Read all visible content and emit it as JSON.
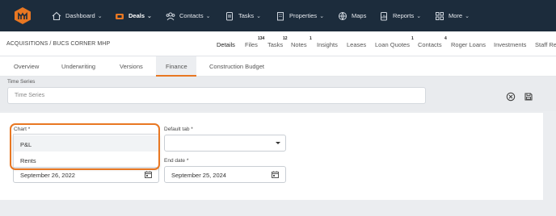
{
  "topnav": {
    "items": [
      {
        "label": "Dashboard",
        "icon": "home-icon",
        "has_menu": true
      },
      {
        "label": "Deals",
        "icon": "deals-icon",
        "has_menu": true,
        "active": true
      },
      {
        "label": "Contacts",
        "icon": "contacts-icon",
        "has_menu": true
      },
      {
        "label": "Tasks",
        "icon": "tasks-icon",
        "has_menu": true
      },
      {
        "label": "Properties",
        "icon": "building-icon",
        "has_menu": true
      },
      {
        "label": "Maps",
        "icon": "globe-icon",
        "has_menu": false
      },
      {
        "label": "Reports",
        "icon": "reports-icon",
        "has_menu": true
      },
      {
        "label": "More",
        "icon": "grid-icon",
        "has_menu": true
      }
    ],
    "accent": "#e87722",
    "bg": "#1c2c3c"
  },
  "breadcrumb": "ACQUISITIONS / BUCS CORNER MHP",
  "record_tabs": [
    {
      "label": "Details",
      "active": true
    },
    {
      "label": "Files",
      "badge": "134"
    },
    {
      "label": "Tasks",
      "badge": "12"
    },
    {
      "label": "Notes",
      "badge": "1"
    },
    {
      "label": "Insights"
    },
    {
      "label": "Leases"
    },
    {
      "label": "Loan Quotes",
      "badge": "1"
    },
    {
      "label": "Contacts",
      "badge": "4"
    },
    {
      "label": "Roger Loans"
    },
    {
      "label": "Investments"
    },
    {
      "label": "Staff Re"
    }
  ],
  "sub_tabs": [
    {
      "label": "Overview"
    },
    {
      "label": "Underwriting"
    },
    {
      "label": "Versions"
    },
    {
      "label": "Finance",
      "active": true
    },
    {
      "label": "Construction Budget"
    }
  ],
  "time_series": {
    "label": "Time Series",
    "placeholder": "Time Series"
  },
  "form": {
    "chart_label": "Chart *",
    "chart_options": [
      "P&L",
      "Rents"
    ],
    "default_tab_label": "Default tab *",
    "default_tab_value": "",
    "start_date_value": "September 26, 2022",
    "end_date_label": "End date *",
    "end_date_value": "September 25, 2024"
  }
}
